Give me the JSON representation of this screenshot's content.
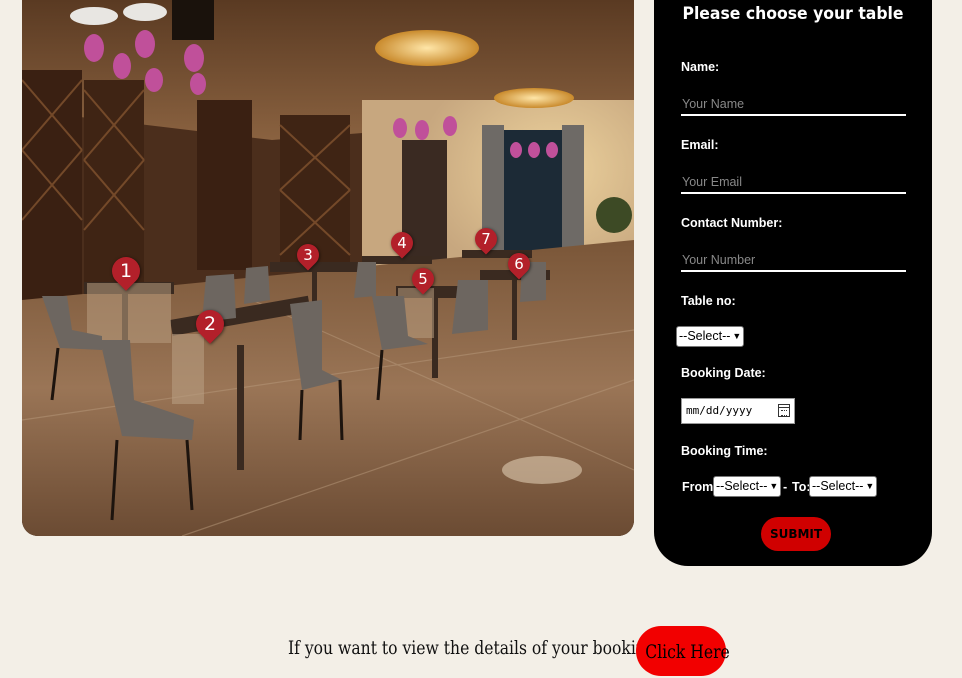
{
  "photo": {
    "alt_subject": "restaurant interior",
    "table_markers": [
      {
        "number": "1"
      },
      {
        "number": "2"
      },
      {
        "number": "3"
      },
      {
        "number": "4"
      },
      {
        "number": "5"
      },
      {
        "number": "6"
      },
      {
        "number": "7"
      }
    ]
  },
  "form": {
    "title": "Please choose your table",
    "name_label": "Name:",
    "name_placeholder": "Your Name",
    "email_label": "Email:",
    "email_placeholder": "Your Email",
    "contact_label": "Contact Number:",
    "contact_placeholder": "Your Number",
    "table_label": "Table no:",
    "table_select": "--Select--",
    "date_label": "Booking Date:",
    "date_placeholder": "mm/dd/yyyy",
    "time_label": "Booking Time:",
    "from_label": "From:",
    "from_select": "--Select--",
    "separator": "-",
    "to_label": "To:",
    "to_select": "--Select--",
    "submit_label": "SUBMIT"
  },
  "footer": {
    "text": "If you want to view the details of your booking",
    "link_label": "Click Here"
  },
  "colors": {
    "page_bg": "#f3efe7",
    "panel_bg": "#000000",
    "marker": "#b3202a",
    "submit": "#d00000",
    "link_bg": "#f20000"
  }
}
